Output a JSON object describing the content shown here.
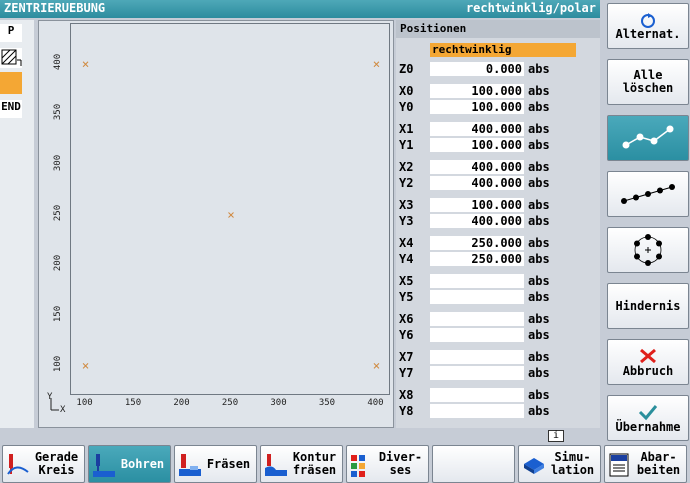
{
  "title": {
    "left": "ZENTRIERUEBUNG",
    "right": "rechtwinklig/polar"
  },
  "leftcol": {
    "p": "P",
    "end": "END"
  },
  "panel": {
    "header": "Positionen",
    "mode": "rechtwinklig",
    "rows": [
      {
        "label": "Z0",
        "value": "0.000",
        "unit": "abs"
      },
      {
        "label": "X0",
        "value": "100.000",
        "unit": "abs"
      },
      {
        "label": "Y0",
        "value": "100.000",
        "unit": "abs"
      },
      {
        "label": "X1",
        "value": "400.000",
        "unit": "abs"
      },
      {
        "label": "Y1",
        "value": "100.000",
        "unit": "abs"
      },
      {
        "label": "X2",
        "value": "400.000",
        "unit": "abs"
      },
      {
        "label": "Y2",
        "value": "400.000",
        "unit": "abs"
      },
      {
        "label": "X3",
        "value": "100.000",
        "unit": "abs"
      },
      {
        "label": "Y3",
        "value": "400.000",
        "unit": "abs"
      },
      {
        "label": "X4",
        "value": "250.000",
        "unit": "abs"
      },
      {
        "label": "Y4",
        "value": "250.000",
        "unit": "abs"
      },
      {
        "label": "X5",
        "value": "",
        "unit": "abs"
      },
      {
        "label": "Y5",
        "value": "",
        "unit": "abs"
      },
      {
        "label": "X6",
        "value": "",
        "unit": "abs"
      },
      {
        "label": "Y6",
        "value": "",
        "unit": "abs"
      },
      {
        "label": "X7",
        "value": "",
        "unit": "abs"
      },
      {
        "label": "Y7",
        "value": "",
        "unit": "abs"
      },
      {
        "label": "X8",
        "value": "",
        "unit": "abs"
      },
      {
        "label": "Y8",
        "value": "",
        "unit": "abs"
      }
    ]
  },
  "plot": {
    "x_ticks": [
      "100",
      "150",
      "200",
      "250",
      "300",
      "350",
      "400"
    ],
    "y_ticks": [
      "100",
      "150",
      "200",
      "250",
      "300",
      "350",
      "400"
    ],
    "axis_x": "X",
    "axis_y": "Y",
    "point_color": "#d08a40",
    "x_range": [
      85,
      415
    ],
    "y_range": [
      70,
      440
    ],
    "points": [
      {
        "x": 100,
        "y": 100
      },
      {
        "x": 400,
        "y": 100
      },
      {
        "x": 400,
        "y": 400
      },
      {
        "x": 100,
        "y": 400
      },
      {
        "x": 250,
        "y": 250
      }
    ]
  },
  "softkeys": {
    "alternat": "Alternat.",
    "alle_1": "Alle",
    "alle_2": "löschen",
    "hindernis": "Hindernis",
    "abbruch": "Abbruch",
    "uebernahme": "Übernahme"
  },
  "bottom": {
    "gerade_1": "Gerade",
    "gerade_2": "Kreis",
    "bohren": "Bohren",
    "fraesen": "Fräsen",
    "kontur_1": "Kontur",
    "kontur_2": "fräsen",
    "diverses_1": "Diver-",
    "diverses_2": "ses",
    "simulation_1": "Simu-",
    "simulation_2": "lation",
    "abarbeiten_1": "Abar-",
    "abarbeiten_2": "beiten"
  },
  "info": "i",
  "colors": {
    "accent": "#2d8c9e",
    "highlight": "#f4a734",
    "abbruch": "#e0201b",
    "uebernahme": "#2a8f9c"
  }
}
